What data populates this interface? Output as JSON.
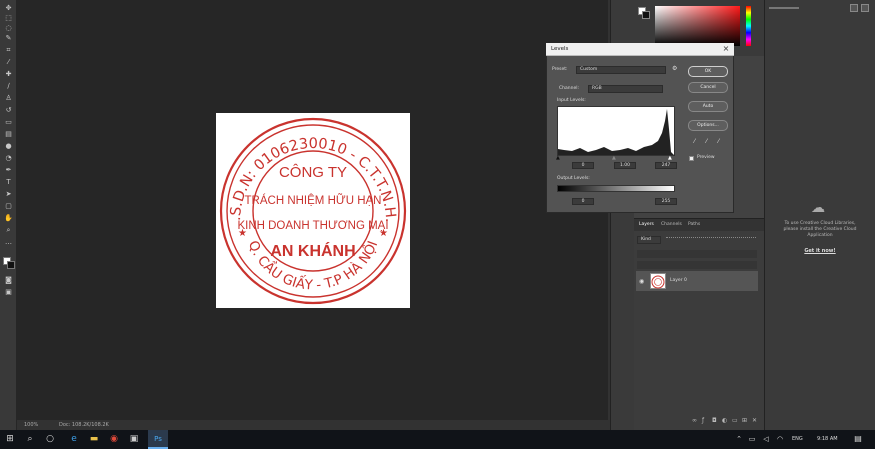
{
  "levels": {
    "title": "Levels",
    "close": "×",
    "preset_label": "Preset:",
    "preset_value": "Custom",
    "channel_label": "Channel:",
    "channel_value": "RGB",
    "input_levels_label": "Input Levels:",
    "input_values": [
      "0",
      "1.00",
      "247"
    ],
    "output_levels_label": "Output Levels:",
    "output_values": [
      "0",
      "255"
    ],
    "buttons": {
      "ok": "OK",
      "cancel": "Cancel",
      "auto": "Auto",
      "options": "Options..."
    },
    "preview_label": "Preview"
  },
  "layers": {
    "tabs": [
      "Layers",
      "Channels",
      "Paths"
    ],
    "kind_label": "Kind",
    "layer_name": "Layer 0"
  },
  "stamp": {
    "outer_text": "M.S.D.N: 0106230010 - C.T.T.N.H.H",
    "bottom_text": "Q. CẦU GIẤY - T.P HÀ NỘI",
    "line1": "CÔNG TY",
    "line2": "TRÁCH NHIỆM HỮU HẠN",
    "line3": "KINH DOANH THƯƠNG MẠI",
    "line4": "AN KHÁNH",
    "color": "#c9332e"
  },
  "status": {
    "zoom": "100%",
    "doc": "Doc: 108.2K/108.2K"
  },
  "creative_cloud": {
    "message": "To use Creative Cloud Libraries, please install the Creative Cloud Application",
    "link": "Get it now!"
  },
  "taskbar": {
    "lang": "ENG",
    "time": "9:18 AM",
    "accent": "#6ab0f0"
  },
  "colors": {
    "app_bg": "#323232",
    "canvas_bg": "#262626",
    "taskbar_bg": "#101318"
  }
}
